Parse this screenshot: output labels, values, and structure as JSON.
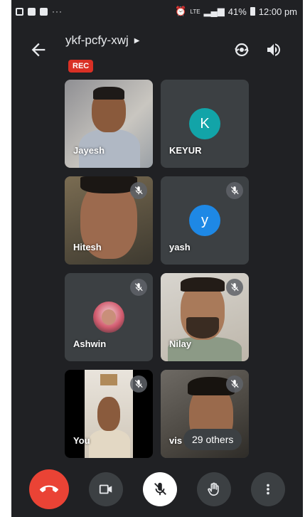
{
  "status_bar": {
    "dots": "···",
    "signal_text": "LTE",
    "battery": "41%",
    "time": "12:00 pm"
  },
  "meeting": {
    "code": "ykf-pcfy-xwj",
    "rec_label": "REC"
  },
  "participants": [
    {
      "name": "Jayesh",
      "type": "video",
      "muted": false
    },
    {
      "name": "KEYUR",
      "type": "avatar",
      "initial": "K",
      "avatar_color": "#12a4a8",
      "muted": false
    },
    {
      "name": "Hitesh",
      "type": "video",
      "muted": true
    },
    {
      "name": "yash",
      "type": "avatar",
      "initial": "y",
      "avatar_color": "#1e88e5",
      "muted": true
    },
    {
      "name": "Ashwin",
      "type": "photo-avatar",
      "muted": true
    },
    {
      "name": "Nilay",
      "type": "video",
      "muted": true
    },
    {
      "name": "You",
      "type": "video",
      "muted": true
    },
    {
      "name": "vis",
      "type": "video",
      "muted": true
    }
  ],
  "others_chip": "29 others",
  "controls": {
    "end_call": "call-end-icon",
    "video": "video-camera-icon",
    "mic": "mic-off-icon",
    "raise_hand": "raise-hand-icon",
    "more": "more-vert-icon"
  },
  "colors": {
    "background": "#202124",
    "tile": "#3c4043",
    "rec": "#d93025",
    "end_call": "#ea4335"
  }
}
